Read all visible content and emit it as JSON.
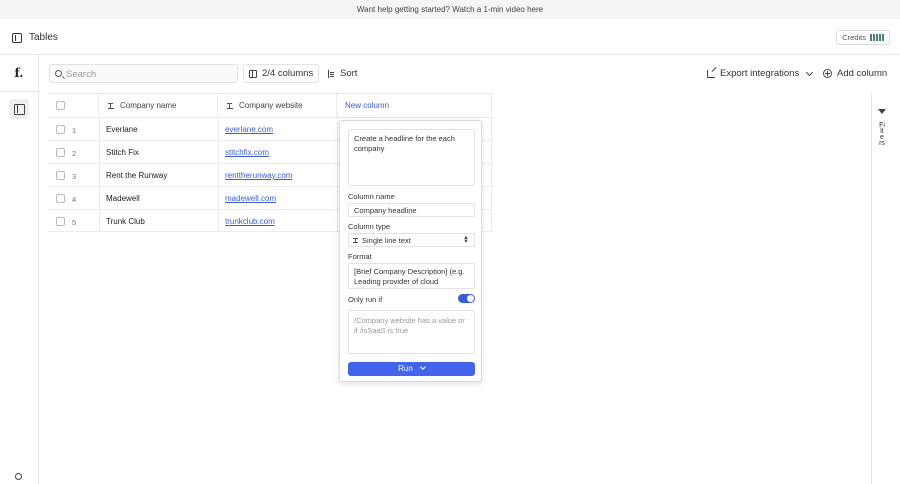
{
  "banner": {
    "text": "Want help getting started? Watch a 1-min video here"
  },
  "header": {
    "title": "Tables",
    "credits_label": "Credits"
  },
  "sidebar": {
    "logo": "f."
  },
  "toolbar": {
    "search_placeholder": "Search",
    "columns_label": "2/4 columns",
    "sort_label": "Sort",
    "export_label": "Export integrations",
    "add_column_label": "Add column"
  },
  "table": {
    "columns": [
      "Company name",
      "Company website",
      "New column"
    ],
    "rows": [
      {
        "num": "1",
        "name": "Everlane",
        "website": "everlane.com"
      },
      {
        "num": "2",
        "name": "Stitch Fix",
        "website": "stitchfix.com"
      },
      {
        "num": "3",
        "name": "Rent the Runway",
        "website": "renttherunway.com"
      },
      {
        "num": "4",
        "name": "Madewell",
        "website": "madewell.com"
      },
      {
        "num": "5",
        "name": "Trunk Club",
        "website": "trunkclub.com"
      }
    ]
  },
  "popover": {
    "prompt": "Create a headline for the each company",
    "column_name_label": "Column name",
    "column_name_value": "Company headline",
    "column_type_label": "Column type",
    "column_type_value": "Single line text",
    "format_label": "Format",
    "format_value": "[Brief Company Description] (e.g. Leading provider of cloud computing solutions)",
    "only_run_if_label": "Only run if",
    "only_run_if_enabled": true,
    "condition_placeholder": "/Company website has a value or if /isSaaS is true",
    "run_label": "Run"
  },
  "filters": {
    "label": "Filters"
  },
  "colors": {
    "accent": "#3b5bdb",
    "run_button": "#4263eb",
    "credits_bar": "#4b7c78"
  }
}
